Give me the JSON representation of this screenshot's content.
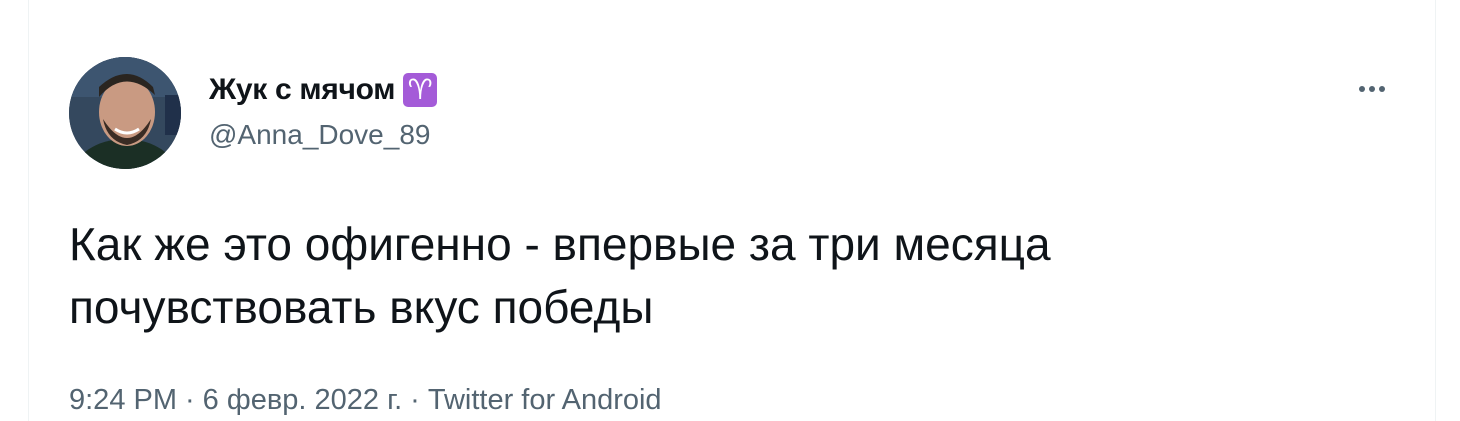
{
  "tweet": {
    "author": {
      "display_name": "Жук с мячом",
      "badge_emoji": "♈",
      "handle": "@Anna_Dove_89",
      "avatar_icon": "user-avatar-photo"
    },
    "more_icon": "more-horizontal-icon",
    "text": "Как же это офигенно - впервые за три месяца\nпочувствовать вкус победы",
    "meta": {
      "time": "9:24 PM",
      "separator": "·",
      "date": "6 февр. 2022 г.",
      "source": "Twitter for Android"
    }
  },
  "colors": {
    "primary_text": "#0f1419",
    "secondary_text": "#536471",
    "badge_bg": "#a45bd8",
    "border": "#eff3f4"
  }
}
